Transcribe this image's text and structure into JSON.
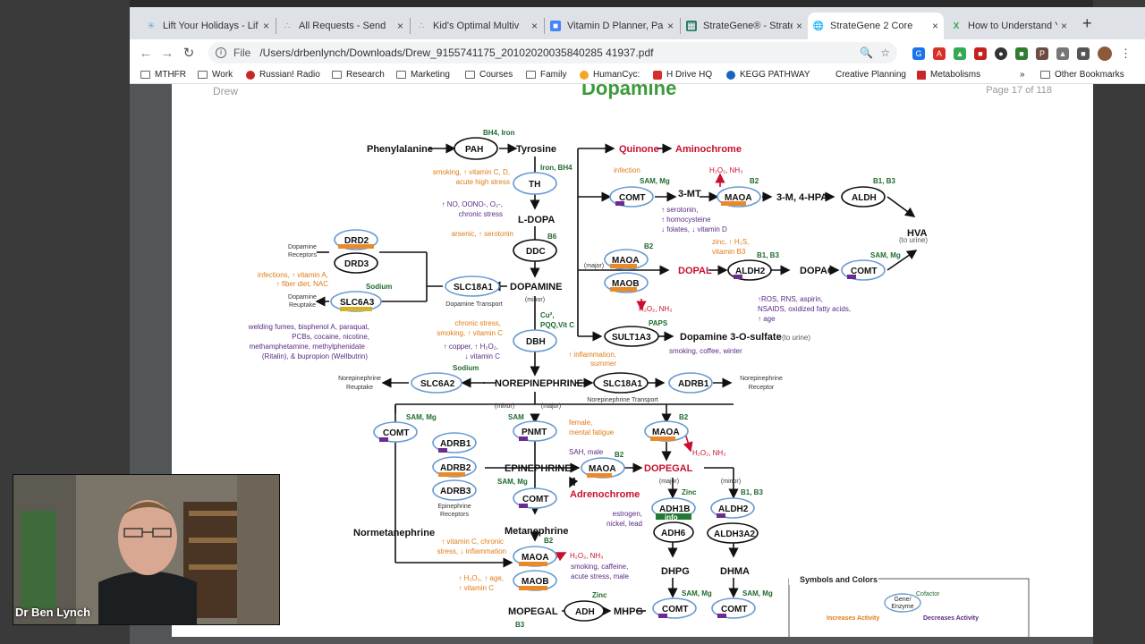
{
  "tabs": [
    {
      "title": "Lift Your Holidays - Lif",
      "color": "#6aa9d8"
    },
    {
      "title": "All Requests - Send",
      "color": "#e06060"
    },
    {
      "title": "Kid's Optimal Multiv",
      "color": "#e06060"
    },
    {
      "title": "Vitamin D Planner, Pa",
      "color": "#4285f4"
    },
    {
      "title": "StrateGene® - Strateg",
      "color": "#2e7d6b"
    },
    {
      "title": "StrateGene 2 Core",
      "color": "#666666"
    },
    {
      "title": "How to Understand Yo",
      "color": "#2eaa4a"
    }
  ],
  "new_tab": "+",
  "close_glyph": "×",
  "omnibox": {
    "scheme": "File",
    "url": "/Users/drbenlynch/Downloads/Drew_9155741175_20102020035840285 41937.pdf"
  },
  "bookmarks": [
    {
      "label": "MTHFR"
    },
    {
      "label": "Work"
    },
    {
      "label": "Russian! Radio"
    },
    {
      "label": "Research"
    },
    {
      "label": "Marketing"
    },
    {
      "label": "Courses"
    },
    {
      "label": "Family"
    },
    {
      "label": "HumanCyc:"
    },
    {
      "label": "H Drive HQ"
    },
    {
      "label": "KEGG PATHWAY"
    },
    {
      "label": "Creative Planning"
    },
    {
      "label": "Metabolisms"
    },
    {
      "label": "»"
    },
    {
      "label": "Other Bookmarks"
    }
  ],
  "page": {
    "header_left": "Drew",
    "title": "Dopamine",
    "page_indicator": "Page 17 of 118"
  },
  "diagram": {
    "phenylalanine": "Phenylalanine",
    "tyrosine": "Tyrosine",
    "l_dopa": "L-DOPA",
    "dopamine": "DOPAMINE",
    "norepinephrine": "NOREPINEPHRINE",
    "epinephrine": "EPINEPHRINE",
    "normetanephrine": "Normetanephrine",
    "metanephrine": "Metanephrine",
    "mopegal": "MOPEGAL",
    "mhpg": "MHPG",
    "dhpg": "DHPG",
    "dhma": "DHMA",
    "dopegal": "DOPEGAL",
    "adrenochrome": "Adrenochrome",
    "quinone": "Quinone",
    "aminochrome": "Aminochrome",
    "three_mt": "3-MT",
    "three_m_4_hpa": "3-M, 4-HPA",
    "hva": "HVA",
    "hva_note": "(to urine)",
    "dopal": "DOPAL",
    "dopac": "DOPAC",
    "dopamine_3_o_sulfate": "Dopamine 3-O-sulfate",
    "sulfate_note": "(to urine)",
    "genes": {
      "pah": "PAH",
      "th": "TH",
      "ddc": "DDC",
      "dbh": "DBH",
      "drd2": "DRD2",
      "drd3": "DRD3",
      "slc6a3": "SLC6A3",
      "slc18a1": "SLC18A1",
      "slc18a1_ne": "SLC18A1",
      "slc6a2": "SLC6A2",
      "adrb1_ne": "ADRB1",
      "comt_3mt": "COMT",
      "maoa_3mt": "MAOA",
      "aldh": "ALDH",
      "maoa_dopal": "MAOA",
      "maob_dopal": "MAOB",
      "aldh2": "ALDH2",
      "comt_hva": "COMT",
      "sult1a3": "SULT1A3",
      "comt_left": "COMT",
      "adrb1": "ADRB1",
      "adrb2": "ADRB2",
      "adrb3": "ADRB3",
      "pnmt": "PNMT",
      "maoa_epi": "MAOA",
      "maoa_dopegal": "MAOA",
      "comt_epi": "COMT",
      "adh1b": "ADH1B",
      "adh6": "ADH6",
      "aldh2_b": "ALDH2",
      "aldh3a2": "ALDH3A2",
      "maoa_met": "MAOA",
      "maob_met": "MAOB",
      "adh": "ADH",
      "comt_dhpg": "COMT",
      "comt_dhma": "COMT"
    },
    "cofactors": {
      "bh4_iron": "BH4, Iron",
      "iron_bh4": "Iron, BH4",
      "b6": "B6",
      "cu_pqq": "Cu²,",
      "pqq_vitc": "PQQ,Vit C",
      "sodium1": "Sodium",
      "sodium2": "Sodium",
      "sam_mg1": "SAM, Mg",
      "b2_1": "B2",
      "b1_b3_1": "B1, B3",
      "b2_2": "B2",
      "b1_b3_2": "B1, B3",
      "sam_mg2": "SAM, Mg",
      "paps": "PAPS",
      "sam_mg3": "SAM, Mg",
      "sam": "SAM",
      "b2_3": "B2",
      "b2_4": "B2",
      "sam_mg4": "SAM, Mg",
      "zinc1": "Zinc",
      "b1_b3_3": "B1, B3",
      "b2_5": "B2",
      "zinc2": "Zinc",
      "sam_mg5": "SAM, Mg",
      "sam_mg6": "SAM, Mg",
      "b3": "B3"
    },
    "notes": {
      "th_inc_1": "smoking, ↑ vitamin C, D,",
      "th_inc_2": "acute high stress",
      "th_dec_1": "↑ NO, OONO-, O₂-,",
      "th_dec_2": "chronic stress",
      "ddc_inc": "arsenic, ↑ serotonin",
      "slc6a3_inc_1": "infections, ↑ vitamin A,",
      "slc6a3_inc_2": "↑ fiber diet, NAC",
      "slc6a3_dec_1": "welding fumes, bisphenol A, paraquat,",
      "slc6a3_dec_2": "PCBs, cocaine, nicotine,",
      "slc6a3_dec_3": "methamphetamine, methylphenidate",
      "slc6a3_dec_4": "(Ritalin), & bupropion (Wellbutrin)",
      "dbh_inc_1": "chronic stress,",
      "dbh_inc_2": "smoking, ↑ vitamin C",
      "dbh_dec_1": "↑ copper, ↑ H₂O₂,",
      "dbh_dec_2": "↓ vitamin C",
      "infection": "infection",
      "comt_dec_1": "↑ serotonin,",
      "comt_dec_2": "↑ homocysteine",
      "comt_dec_3": "↓ folates, ↓ vitamin D",
      "h2o2_nh3_1": "H₂O₂, NH₃",
      "h2o2_nh3_2": "H₂O₂, NH₃",
      "aldh2_inc_1": "zinc, ↑ H₂S,",
      "aldh2_inc_2": "vitamin B3",
      "aldh2_dec_1": "↑ROS, RNS, aspirin,",
      "aldh2_dec_2": "NSAIDS, oxidized fatty acids,",
      "aldh2_dec_3": "↑ age",
      "sult_dec": "smoking, coffee, winter",
      "sult_inc_1": "↑ inflammation,",
      "sult_inc_2": "summer",
      "major": "(major)",
      "minor": "(minor)",
      "dopamine_receptors_1": "Dopamine",
      "dopamine_receptors_2": "Receptors",
      "dopamine_reuptake_1": "Dopamine",
      "dopamine_reuptake_2": "Reuptake",
      "dopamine_transport": "Dopamine Transport",
      "ne_reuptake_1": "Norepinephrine",
      "ne_reuptake_2": "Reuptake",
      "ne_transport": "Norepinephrine Transport",
      "ne_receptor_1": "Norepinephrine",
      "ne_receptor_2": "Receptor",
      "pnmt_inc_1": "female,",
      "pnmt_inc_2": "mental fatigue",
      "pnmt_dec": "SAH, male",
      "h2o2_nh3_3": "H₂O₂, NH₃",
      "epi_receptors_1": "Epinephrine",
      "epi_receptors_2": "Receptors",
      "adh1b_dec_1": "estrogen,",
      "adh1b_dec_2": "nickel, lead",
      "info": "info",
      "met_inc_1": "↑ vitamin C, chronic",
      "met_inc_2": "stress, ↓ inflammation",
      "met_dec_1": "smoking, caffeine,",
      "met_dec_2": "acute stress, male",
      "h2o2_nh3_4": "H₂O₂, NH₃",
      "maob_inc_1": "↑ H₂O₂, ↑ age,",
      "maob_inc_2": "↑ vitamin C"
    },
    "legend": {
      "title": "Symbols and Colors",
      "gene": "Gene/",
      "enzyme": "Enzyme",
      "cofactor": "Cofactor",
      "increases": "Increases Activity",
      "decreases": "Decreases Activity"
    }
  },
  "webcam": {
    "name": "Dr Ben Lynch"
  }
}
